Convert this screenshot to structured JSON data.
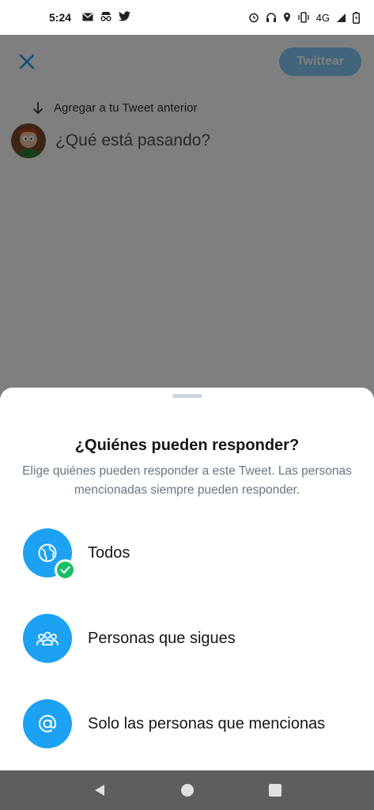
{
  "status_bar": {
    "time": "5:24",
    "network": "4G",
    "left_icons": [
      "gmail-icon",
      "incognito-icon",
      "twitter-icon"
    ],
    "right_icons": [
      "alarm-icon",
      "headset-icon",
      "location-icon",
      "vibrate-icon",
      "signal-icon",
      "battery-icon"
    ]
  },
  "compose": {
    "tweet_button_label": "Twittear",
    "add_to_previous_label": "Agregar a tu Tweet anterior",
    "input_placeholder": "¿Qué está pasando?"
  },
  "sheet": {
    "title": "¿Quiénes pueden responder?",
    "description": "Elige quiénes pueden responder a este Tweet. Las personas mencionadas siempre pueden responder.",
    "options": [
      {
        "label": "Todos",
        "icon": "globe-icon",
        "selected": true
      },
      {
        "label": "Personas que sigues",
        "icon": "people-icon",
        "selected": false
      },
      {
        "label": "Solo las personas que mencionas",
        "icon": "at-icon",
        "selected": false
      }
    ]
  },
  "colors": {
    "accent": "#1da1f2",
    "check": "#17bf63",
    "secondary_text": "#657786"
  }
}
